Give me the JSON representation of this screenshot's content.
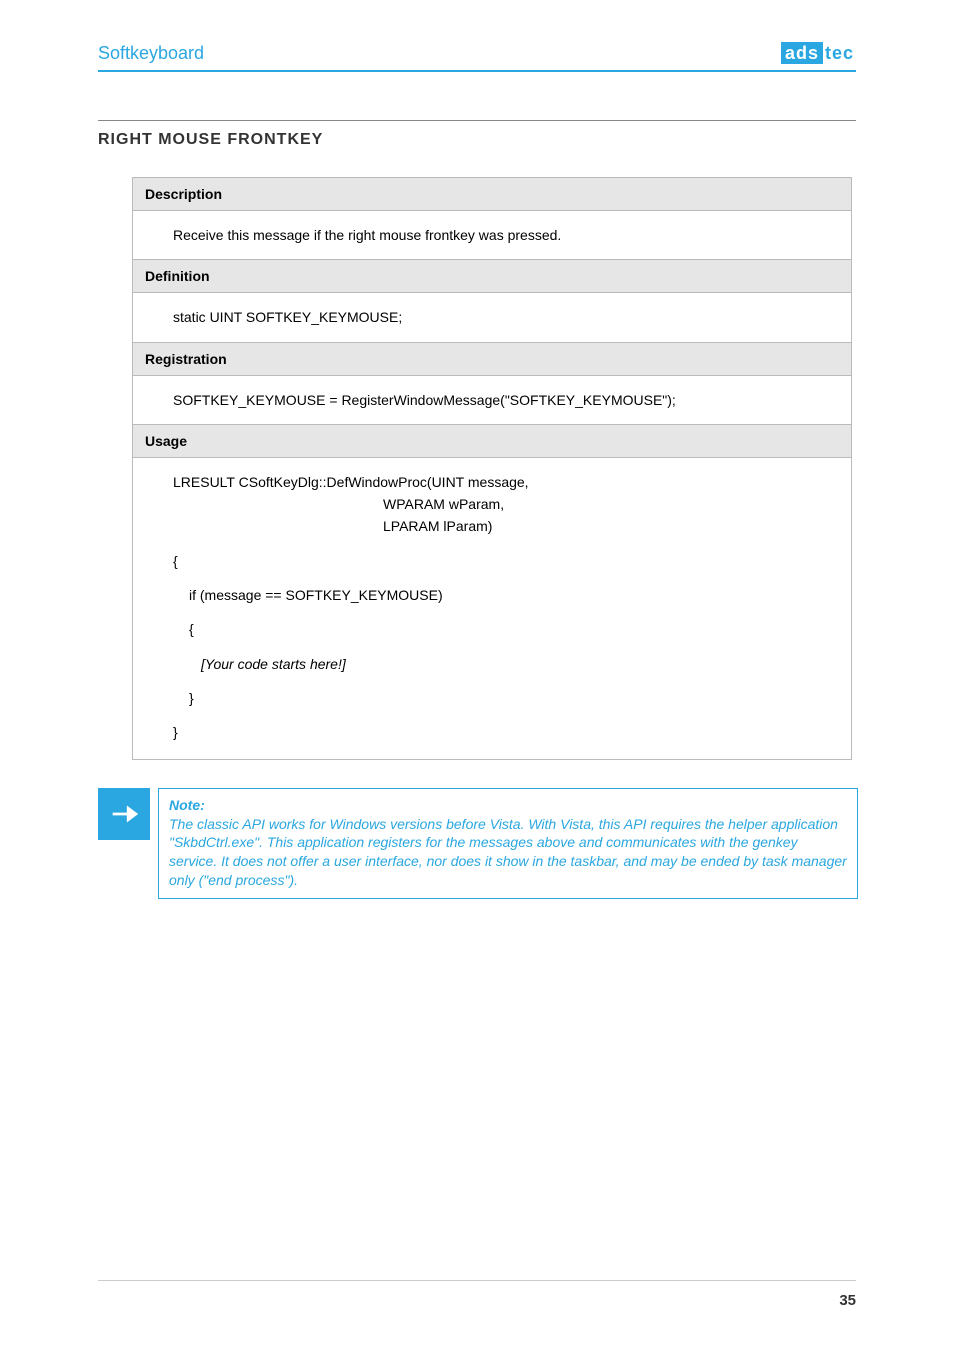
{
  "header": {
    "product_name": "Softkeyboard",
    "logo_box": "ads",
    "logo_suffix": "tec"
  },
  "section": {
    "heading": "RIGHT MOUSE FRONTKEY"
  },
  "api": {
    "description_label": "Description",
    "description_text": "Receive this message if the right mouse frontkey was pressed.",
    "definition_label": "Definition",
    "definition_text": "static UINT SOFTKEY_KEYMOUSE;",
    "registration_label": "Registration",
    "registration_text": "SOFTKEY_KEYMOUSE = RegisterWindowMessage(\"SOFTKEY_KEYMOUSE\");",
    "usage_label": "Usage",
    "usage_lines": {
      "l1": "LRESULT CSoftKeyDlg::DefWindowProc(UINT message,",
      "l2": "WPARAM wParam,",
      "l3": "LPARAM lParam)",
      "l4": "{",
      "l5": "if (message == SOFTKEY_KEYMOUSE)",
      "l6": "{",
      "l7": "[Your code starts here!]",
      "l8": "}",
      "l9": "}"
    }
  },
  "note": {
    "title": "Note:",
    "body": "The classic API works for Windows versions before Vista. With Vista, this API requires the helper application \"SkbdCtrl.exe\". This application registers for the messages above and communicates with the genkey service. It does not offer a user interface, nor does it show in the taskbar, and may be ended by task manager only (\"end process\")."
  },
  "footer": {
    "page_number": "35"
  }
}
